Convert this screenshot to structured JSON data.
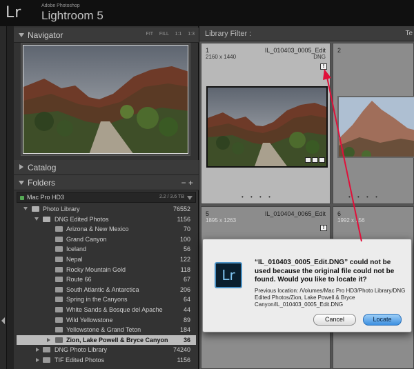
{
  "app": {
    "logo": "Lr",
    "vendor": "Adobe Photoshop",
    "name": "Lightroom 5"
  },
  "navigator": {
    "title": "Navigator",
    "options": [
      "FIT",
      "FILL",
      "1:1",
      "1:3"
    ]
  },
  "catalog": {
    "title": "Catalog"
  },
  "folders": {
    "title": "Folders",
    "controls": "− +",
    "volume": {
      "name": "Mac Pro HD3",
      "size": "2.2 / 3.6 TB"
    },
    "items": [
      {
        "label": "Photo Library",
        "count": "76552"
      },
      {
        "label": "DNG Edited Photos",
        "count": "1156"
      },
      {
        "label": "Arizona & New Mexico",
        "count": "70"
      },
      {
        "label": "Grand Canyon",
        "count": "100"
      },
      {
        "label": "Iceland",
        "count": "56"
      },
      {
        "label": "Nepal",
        "count": "122"
      },
      {
        "label": "Rocky Mountain Gold",
        "count": "118"
      },
      {
        "label": "Route 66",
        "count": "67"
      },
      {
        "label": "South Atlantic & Antarctica",
        "count": "206"
      },
      {
        "label": "Spring in the Canyons",
        "count": "64"
      },
      {
        "label": "White Sands & Bosque del Apache",
        "count": "44"
      },
      {
        "label": "Wild Yellowstone",
        "count": "89"
      },
      {
        "label": "Yellowstone & Grand Teton",
        "count": "184"
      },
      {
        "label": "Zion, Lake Powell & Bryce Canyon",
        "count": "36"
      },
      {
        "label": "DNG Photo Library",
        "count": "74240"
      },
      {
        "label": "TIF Edited Photos",
        "count": "1156"
      }
    ]
  },
  "library_filter": {
    "label": "Library Filter :",
    "right": "Te"
  },
  "grid": {
    "cells": [
      {
        "num": "1",
        "name": "IL_010403_0005_Edit",
        "dims": "2160 x 1440",
        "ext": "DNG",
        "missing": "!"
      },
      {
        "num": "2",
        "name": "",
        "dims": "",
        "ext": ""
      },
      {
        "num": "5",
        "name": "IL_010404_0065_Edit",
        "dims": "1895 x 1263",
        "ext": "",
        "missing": "!"
      },
      {
        "num": "6",
        "name": "",
        "dims": "1992 x 156",
        "ext": ""
      }
    ],
    "dots": "• • • •"
  },
  "dialog": {
    "logo": "Lr",
    "message": "“IL_010403_0005_Edit.DNG” could not be used because the original file could not be found. Would you like to locate it?",
    "previous": "Previous location: /Volumes/Mac Pro HD3/Photo Library/DNG Edited Photos/Zion, Lake Powell & Bryce Canyon/IL_010403_0005_Edit.DNG",
    "cancel": "Cancel",
    "locate": "Locate"
  },
  "colors": {
    "annotation_arrow": "#e0103a",
    "locate_button": "#3c8fe0",
    "selected_row": "#bcbcbc"
  }
}
